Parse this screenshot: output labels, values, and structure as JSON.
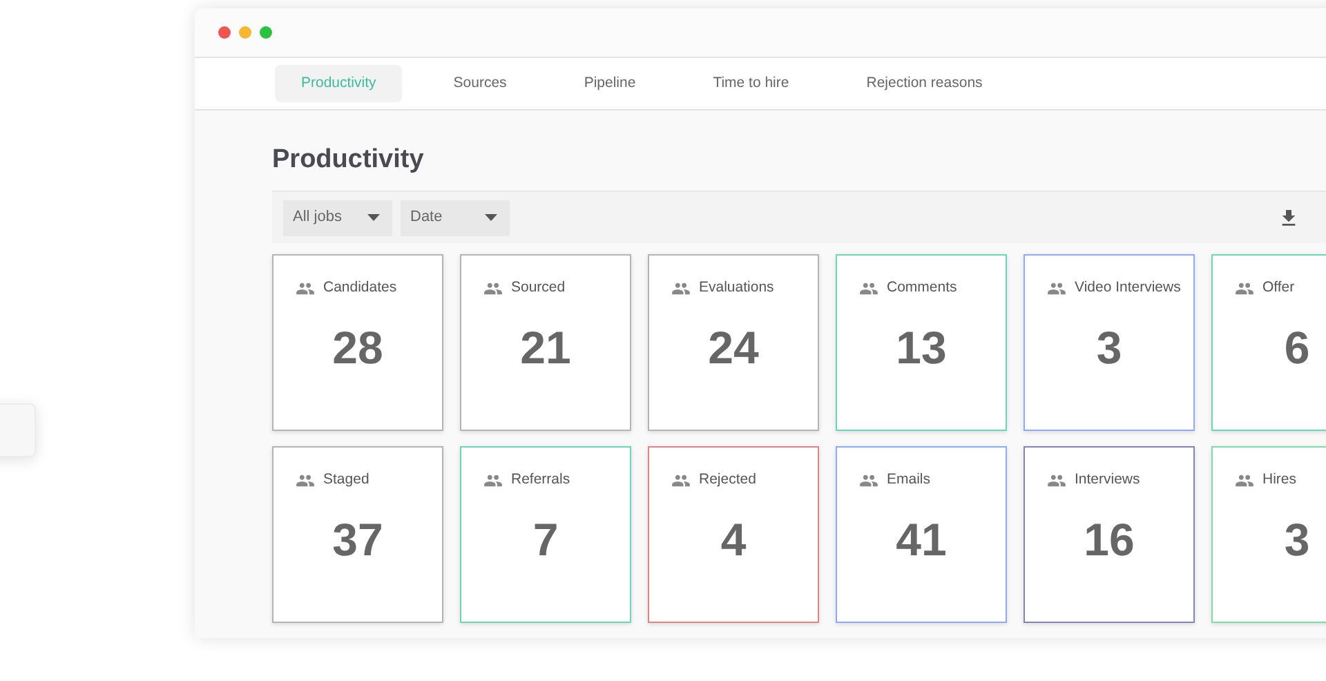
{
  "tabs": [
    {
      "label": "Productivity",
      "selected": true
    },
    {
      "label": "Sources",
      "selected": false
    },
    {
      "label": "Pipeline",
      "selected": false
    },
    {
      "label": "Time to hire",
      "selected": false
    },
    {
      "label": "Rejection reasons",
      "selected": false
    }
  ],
  "heading": "Productivity",
  "filters": [
    {
      "label": "All jobs"
    },
    {
      "label": "Date"
    }
  ],
  "cards": [
    {
      "label": "Candidates",
      "value": "28",
      "color": "#b4b4b4"
    },
    {
      "label": "Sourced",
      "value": "21",
      "color": "#b4b4b4"
    },
    {
      "label": "Evaluations",
      "value": "24",
      "color": "#b4b4b4"
    },
    {
      "label": "Comments",
      "value": "13",
      "color": "#6fd5b8"
    },
    {
      "label": "Video Interviews",
      "value": "3",
      "color": "#8eaaf2"
    },
    {
      "label": "Offer",
      "value": "6",
      "color": "#6fd5b8"
    },
    {
      "label": "Staged",
      "value": "37",
      "color": "#b4b4b4"
    },
    {
      "label": "Referrals",
      "value": "7",
      "color": "#6fd5b8"
    },
    {
      "label": "Rejected",
      "value": "4",
      "color": "#e08585"
    },
    {
      "label": "Emails",
      "value": "41",
      "color": "#8eaaf2"
    },
    {
      "label": "Interviews",
      "value": "16",
      "color": "#7f88b3"
    },
    {
      "label": "Hires",
      "value": "3",
      "color": "#7fdba7"
    }
  ]
}
